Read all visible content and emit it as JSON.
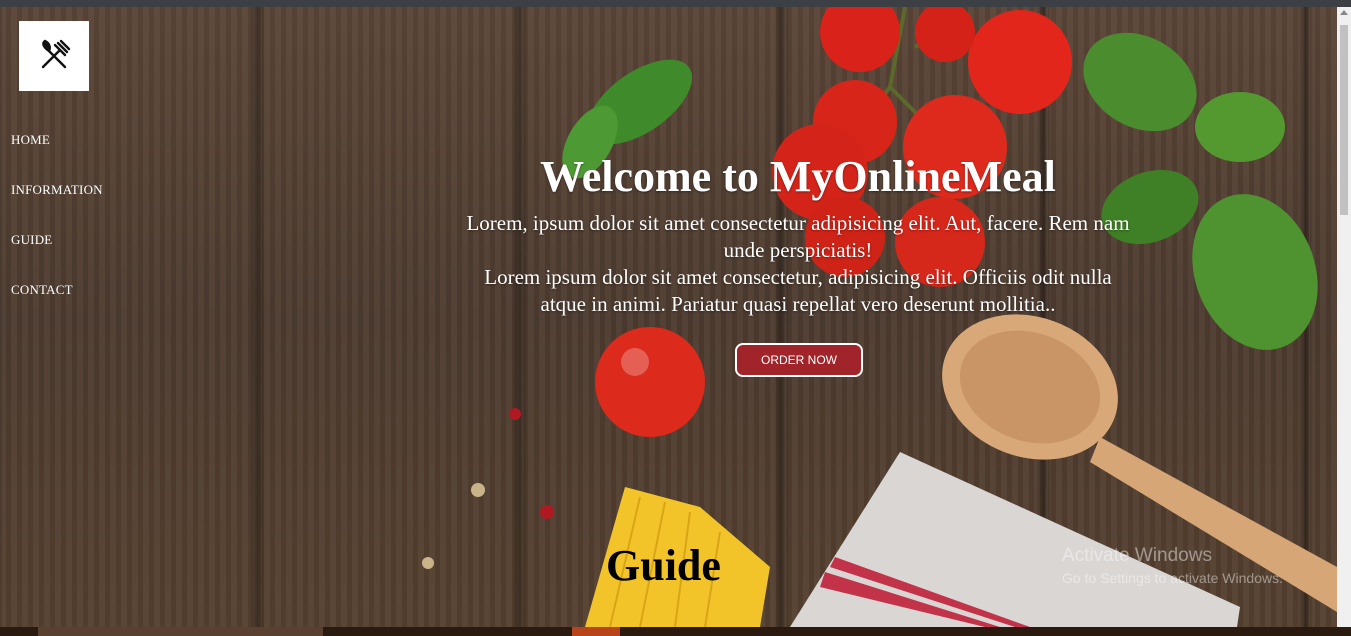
{
  "nav": {
    "items": [
      {
        "label": "HOME"
      },
      {
        "label": "INFORMATION"
      },
      {
        "label": "GUIDE"
      },
      {
        "label": "CONTACT"
      }
    ]
  },
  "hero": {
    "title": "Welcome to MyOnlineMeal",
    "paragraph1": "Lorem, ipsum dolor sit amet consectetur adipisicing elit. Aut, facere. Rem nam unde perspiciatis!",
    "paragraph2": "Lorem ipsum dolor sit amet consectetur, adipisicing elit. Officiis odit nulla atque in animi. Pariatur quasi repellat vero deserunt mollitia..",
    "cta_label": "ORDER NOW"
  },
  "guide": {
    "heading": "Guide"
  },
  "os_watermark": {
    "line1": "Activate Windows",
    "line2": "Go to Settings to activate Windows."
  },
  "icons": {
    "logo": "fork-and-knife-icon"
  },
  "colors": {
    "cta_background": "#a0242a",
    "nav_text": "#ffffff"
  }
}
